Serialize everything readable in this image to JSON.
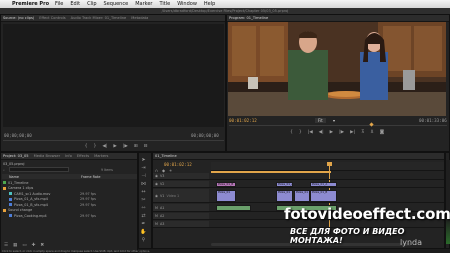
{
  "menubar": {
    "app": "Premiere Pro",
    "items": [
      "File",
      "Edit",
      "Clip",
      "Sequence",
      "Marker",
      "Title",
      "Window",
      "Help"
    ]
  },
  "window_title": "/Users/dbradford/Desktop/Exercise Files/Project/Chapter 05/03_05.prproj",
  "source_monitor": {
    "tabs": [
      "Source: (no clips)",
      "Effect Controls",
      "Audio Track Mixer: 01_Timeline",
      "Metadata"
    ],
    "tc_left": "00;00;00;00",
    "tc_right": "00;00;00;00"
  },
  "program_monitor": {
    "tab": "Program: 01_Timeline",
    "tc_current": "00:01:02:12",
    "zoom": "Fit",
    "tc_duration": "00:01:33:06"
  },
  "project_panel": {
    "tabs": [
      "Project: 03_05",
      "Media Browser",
      "Info",
      "Effects",
      "Markers"
    ],
    "name": "03_05.prproj",
    "count": "9 Items",
    "headers": {
      "name": "Name",
      "rate": "Frame Rate"
    },
    "rows": [
      {
        "name": "01_Timeline",
        "rate": "",
        "color": "#4fa84f"
      },
      {
        "name": "Camera 1 clips",
        "rate": "",
        "color": "#e8a23c"
      },
      {
        "name": "CAM1_sc1 Audio.mov",
        "rate": "29.97 fps",
        "color": "#4ec0c0"
      },
      {
        "name": "Pizza_01_A_sfx.mp4",
        "rate": "29.97 fps",
        "color": "#4e7ed8"
      },
      {
        "name": "Pizza_01_B_sfx.mp4",
        "rate": "29.97 fps",
        "color": "#4e7ed8"
      },
      {
        "name": "Sound change",
        "rate": "",
        "color": "#e8a23c"
      },
      {
        "name": "Pizza_Cooking.mp4",
        "rate": "29.97 fps",
        "color": "#4e7ed8"
      }
    ],
    "status": "Click to select, or click in empty space and drag to marquee select. Use Shift, Opt, and Cmd for other options."
  },
  "timeline": {
    "tab": "01_Timeline",
    "tc": "00:01:02:12",
    "tracks": [
      "V3",
      "V2",
      "V1",
      "A1",
      "A2",
      "A3"
    ],
    "v1_label": "Video 1",
    "clips": {
      "v2a": "Pizza_01_B",
      "v2b": "Pizza_01_A",
      "v2c": "Pizza_01_A",
      "v1a": "Pizza_01",
      "v1b": "Pizza_01",
      "v1c": "Pizza_01",
      "v1d": "Pizza_01_B"
    }
  },
  "watermark": {
    "line1": "fotovideoeffect.com",
    "line2": "ВСЕ ДЛЯ ФОТО И ВИДЕО МОНТАЖА!",
    "line3": "lynda"
  }
}
